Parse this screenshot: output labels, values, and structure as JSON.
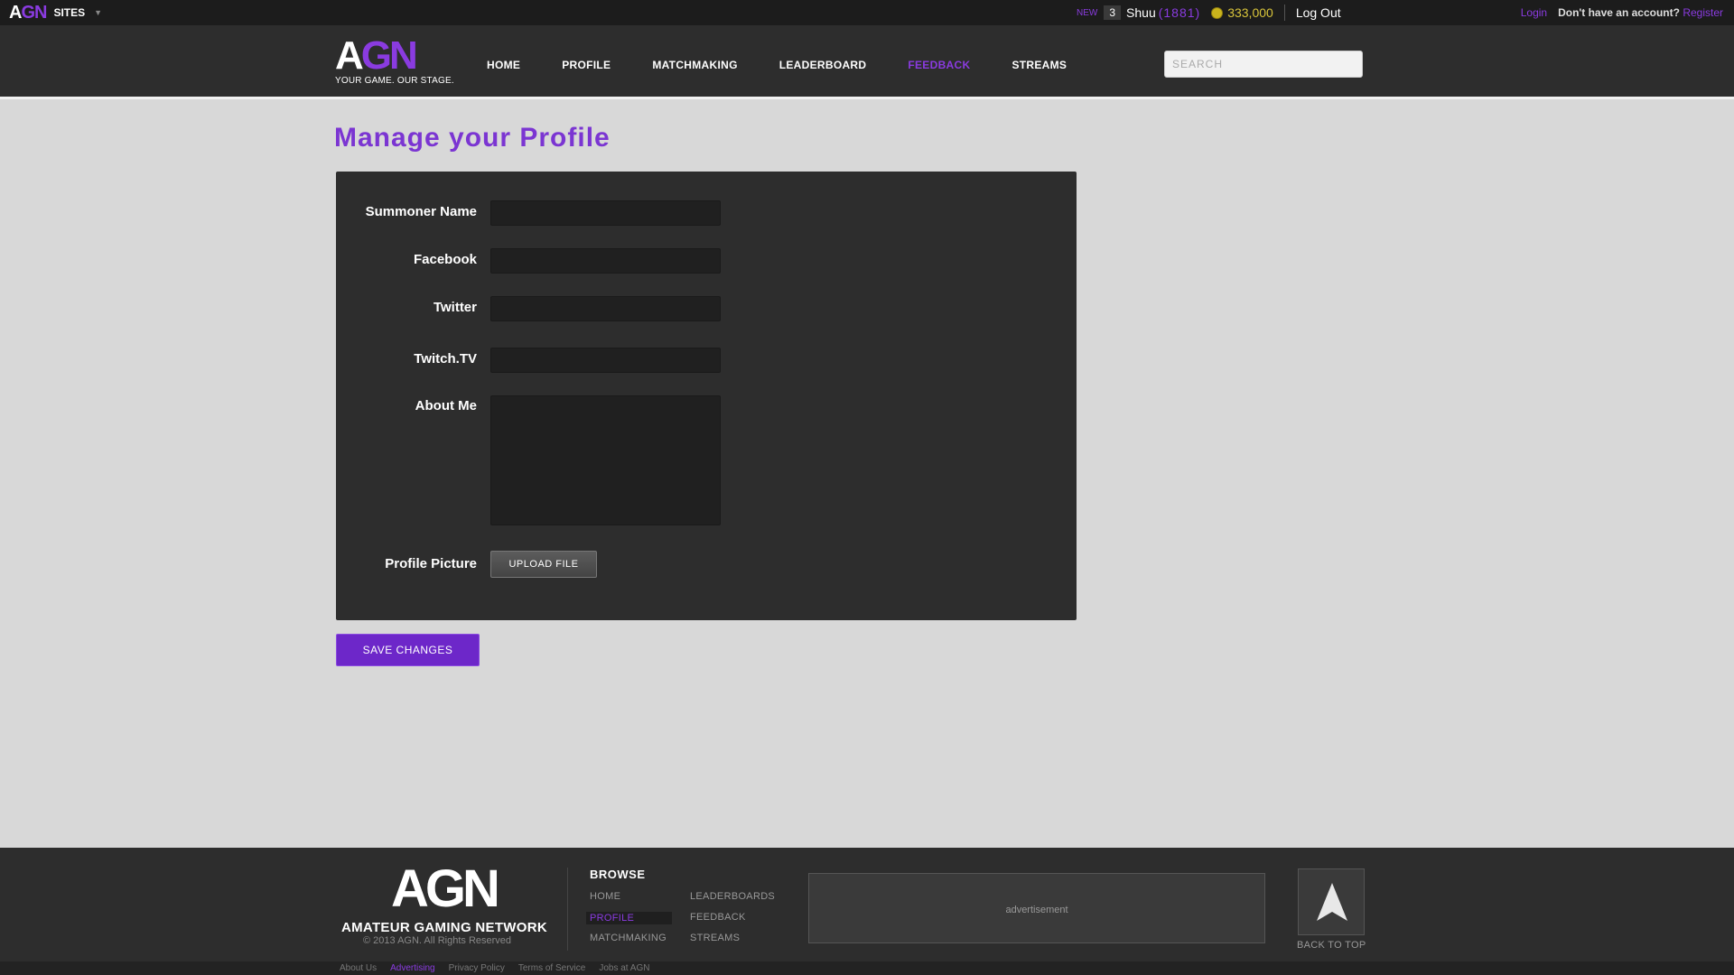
{
  "topbar": {
    "logo_a": "A",
    "logo_gn": "GN",
    "sites_label": "SITES",
    "new_label": "NEW",
    "new_count": "3",
    "username": "Shuu",
    "rating": "(1881)",
    "coins": "333,000",
    "logout": "Log Out",
    "login": "Login",
    "no_account": "Don't have an account?",
    "register": "Register"
  },
  "header": {
    "logo_a": "A",
    "logo_gn": "GN",
    "tagline": "YOUR GAME. OUR STAGE.",
    "nav": [
      "HOME",
      "PROFILE",
      "MATCHMAKING",
      "LEADERBOARD",
      "FEEDBACK",
      "STREAMS"
    ],
    "active_nav": "FEEDBACK",
    "search_placeholder": "SEARCH"
  },
  "main": {
    "title": "Manage your Profile",
    "fields": {
      "summoner": {
        "label": "Summoner Name",
        "value": ""
      },
      "facebook": {
        "label": "Facebook",
        "value": ""
      },
      "twitter": {
        "label": "Twitter",
        "value": ""
      },
      "twitch": {
        "label": "Twitch.TV",
        "value": ""
      },
      "about": {
        "label": "About Me",
        "value": ""
      },
      "picture": {
        "label": "Profile Picture",
        "button": "UPLOAD FILE"
      }
    },
    "save_button": "SAVE CHANGES"
  },
  "footer": {
    "logo": "AGN",
    "name": "AMATEUR GAMING NETWORK",
    "copyright": "© 2013 AGN. All Rights Reserved",
    "browse_title": "BROWSE",
    "browse_col1": [
      "HOME",
      "PROFILE",
      "MATCHMAKING"
    ],
    "browse_col2": [
      "LEADERBOARDS",
      "FEEDBACK",
      "STREAMS"
    ],
    "browse_active": "PROFILE",
    "ad_text": "advertisement",
    "back_to_top": "BACK TO TOP",
    "sublinks": [
      "About Us",
      "Advertising",
      "Privacy Policy",
      "Terms of Service",
      "Jobs at AGN"
    ],
    "sublinks_active": "Advertising"
  },
  "colors": {
    "accent": "#8a3be0",
    "save_button": "#6d27c9",
    "panel": "#2d2d2d",
    "page_bg": "#d8d8d8",
    "coins": "#d8c43a"
  },
  "icons": {
    "dropdown": "chevron-down-icon",
    "coin": "coin-icon",
    "back_to_top": "arrow-up-icon"
  }
}
